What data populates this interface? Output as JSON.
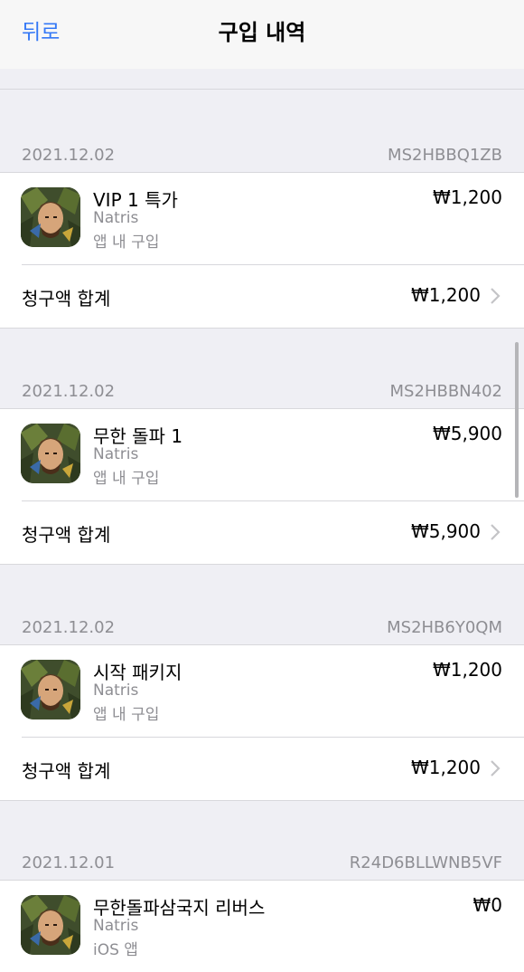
{
  "nav": {
    "back_label": "뒤로",
    "title": "구입 내역"
  },
  "groups": [
    {
      "date": "2021.12.02",
      "order_id": "MS2HBBQ1ZB",
      "item": {
        "name": "VIP 1 특가",
        "developer": "Natris",
        "type": "앱 내 구입",
        "price": "₩1,200"
      },
      "total_label": "청구액 합계",
      "total_price": "₩1,200"
    },
    {
      "date": "2021.12.02",
      "order_id": "MS2HBBN402",
      "item": {
        "name": "무한 돌파 1",
        "developer": "Natris",
        "type": "앱 내 구입",
        "price": "₩5,900"
      },
      "total_label": "청구액 합계",
      "total_price": "₩5,900"
    },
    {
      "date": "2021.12.02",
      "order_id": "MS2HB6Y0QM",
      "item": {
        "name": "시작 패키지",
        "developer": "Natris",
        "type": "앱 내 구입",
        "price": "₩1,200"
      },
      "total_label": "청구액 합계",
      "total_price": "₩1,200"
    },
    {
      "date": "2021.12.01",
      "order_id": "R24D6BLLWNB5VF",
      "item": {
        "name": "무한돌파삼국지 리버스",
        "developer": "Natris",
        "type": "iOS 앱",
        "price": "₩0"
      }
    }
  ]
}
